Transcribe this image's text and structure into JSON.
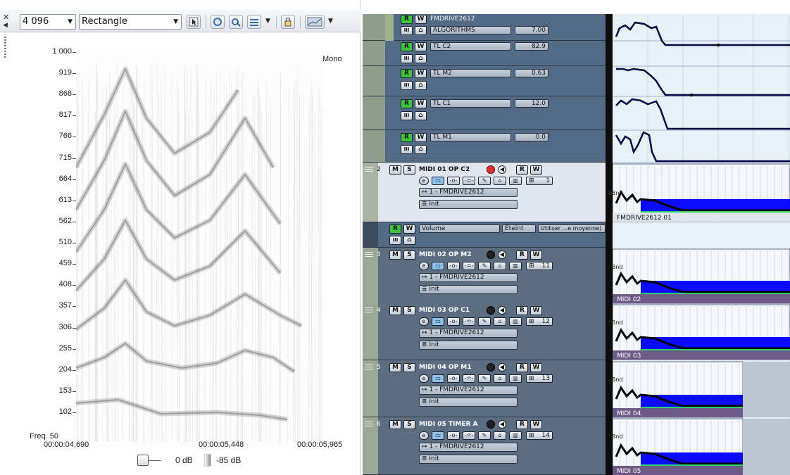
{
  "spectrum": {
    "fft_size": "4 096",
    "window": "Rectangle",
    "channel": "Mono",
    "y_labels": [
      "1 000",
      "919",
      "868",
      "817",
      "766",
      "715",
      "664",
      "613",
      "562",
      "510",
      "459",
      "408",
      "357",
      "306",
      "255",
      "204",
      "153",
      "102"
    ],
    "freq_label": "Freq. 50",
    "x_labels": [
      "00:00:04,690",
      "00:00:05,448",
      "00:00:05,965"
    ],
    "gain_value": "0 dB",
    "floor_value": "-85 dB"
  },
  "automation_tracks": [
    {
      "name": "FMDRIVE2612",
      "param": "ALGORITHMS",
      "value": "7.00"
    },
    {
      "name": "TL C2",
      "value": "82.9"
    },
    {
      "name": "TL M2",
      "value": "0.63"
    },
    {
      "name": "TL C1",
      "value": "12.0"
    },
    {
      "name": "TL M1",
      "value": "0.0"
    }
  ],
  "midi_tracks": [
    {
      "number": "2",
      "name": "MIDI 01 OP C2",
      "output": "1 - FMDRIVE2612",
      "program": "Init",
      "channel": "1",
      "clip": "FMDRIVE2612 01"
    },
    {
      "number": "3",
      "name": "MIDI 02 OP M2",
      "output": "1 - FMDRIVE2612",
      "program": "Init",
      "channel": "11",
      "clip": "MIDI 02"
    },
    {
      "number": "4",
      "name": "MIDI 03 OP C1",
      "output": "1 - FMDRIVE2612",
      "program": "Init",
      "channel": "12",
      "clip": "MIDI 03"
    },
    {
      "number": "5",
      "name": "MIDI 04 OP M1",
      "output": "1 - FMDRIVE2612",
      "program": "Init",
      "channel": "13",
      "clip": "MIDI 04"
    },
    {
      "number": "6",
      "name": "MIDI 05 TIMER A",
      "output": "1 - FMDRIVE2612",
      "program": "Init",
      "channel": "14",
      "clip": "MIDI 05"
    }
  ],
  "volume_lane": {
    "name": "Volume",
    "state": "Éteint",
    "mode": "Utiliser ...e moyenne)"
  },
  "labels": {
    "r": "R",
    "w": "W",
    "m": "M",
    "s": "S",
    "e": "e",
    "pbnd": "PBnd",
    "read_icon": "III"
  },
  "colors": {
    "accent_green": "#3ec53e",
    "record_red": "#e03030",
    "midi_blue": "#0a0aff",
    "clip_purple": "#6e5a86"
  }
}
